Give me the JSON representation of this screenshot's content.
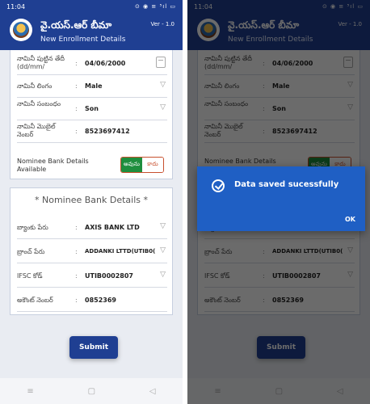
{
  "status_bar": {
    "time": "11:04",
    "icons": "⊙ ◉ ≡ ⁵ıl ▭"
  },
  "header": {
    "title": "వై.యస్.ఆర్ బీమా",
    "subtitle": "New Enrollment Details",
    "version": "Ver - 1.0"
  },
  "nominee": {
    "dob_label": "నామినీ పుట్టిన తేదీ (dd/mm/",
    "dob_value": "04/06/2000",
    "gender_label": "నామినీ లింగం",
    "gender_value": "Male",
    "relation_label": "నామినీ సంబంధం",
    "relation_value": "Son",
    "mobile_label": "నామినీ మొబైల్ నెంబర్",
    "mobile_value": "8523697412",
    "bank_available_label": "Nominee Bank Details Available",
    "toggle_yes": "అవును",
    "toggle_no": "కాదు",
    "separator": ":"
  },
  "bank": {
    "title": "* Nominee Bank Details *",
    "bank_label": "బ్యాంకు పేరు",
    "bank_value": "AXIS BANK LTD",
    "branch_label": "బ్రాంచ్ పేరు",
    "branch_value": "ADDANKI LTTD(UTIB0(",
    "ifsc_label": "IFSC కోడ్",
    "ifsc_value": "UTIB0002807",
    "account_label": "అకౌంట్ నెంబర్",
    "account_value": "0852369"
  },
  "submit_label": "Submit",
  "nav": {
    "home": "≡",
    "recent": "▢",
    "back": "◁"
  },
  "dialog": {
    "message": "Data saved sucessfully",
    "ok": "OK"
  },
  "colors": {
    "primary": "#1f3f92",
    "dialog": "#1f5fc4",
    "toggle_yes": "#1e8e3e",
    "toggle_no": "#c8502e"
  }
}
